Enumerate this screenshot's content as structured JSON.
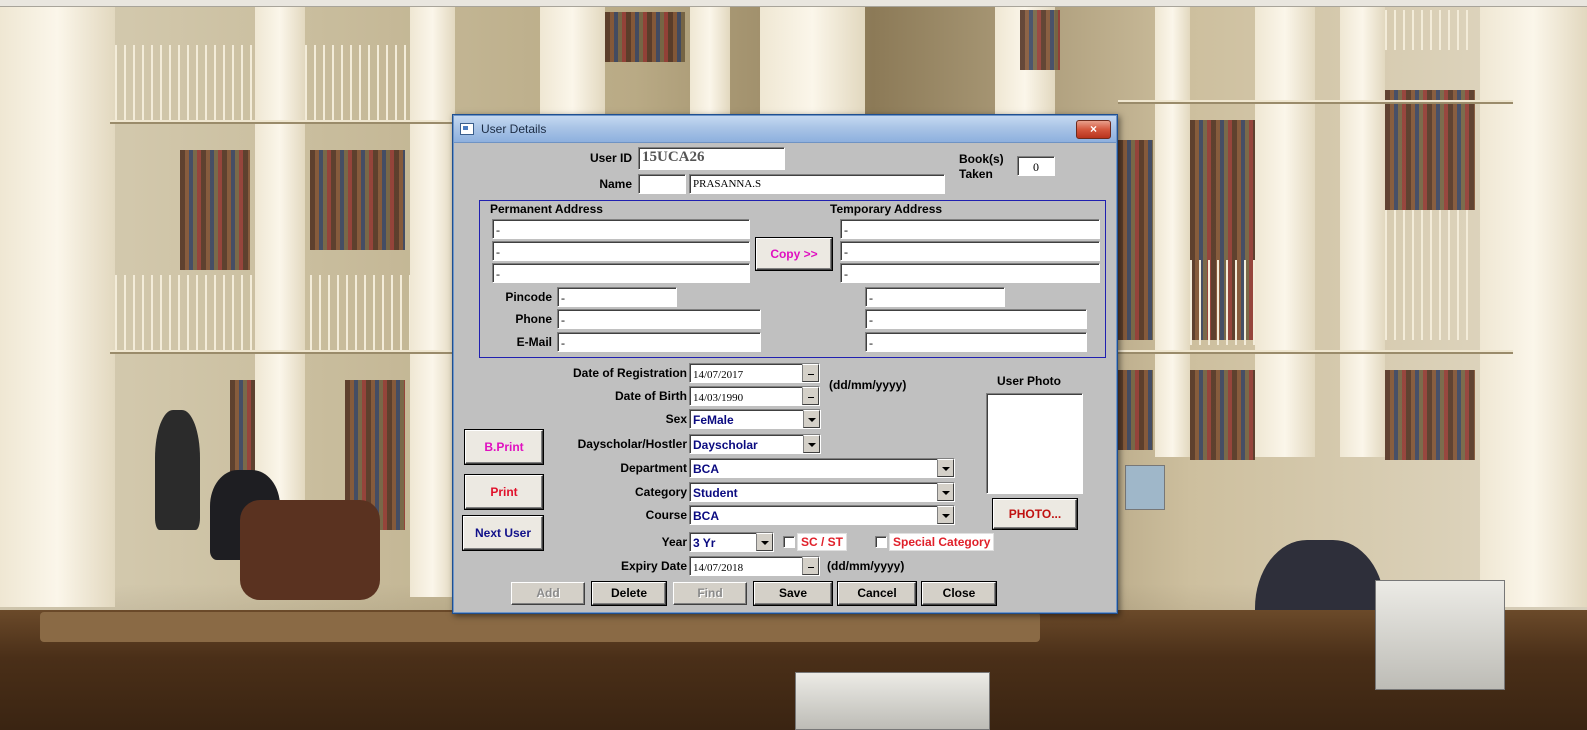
{
  "window": {
    "title": "User Details",
    "close_label": "×"
  },
  "user": {
    "user_id_label": "User ID",
    "user_id_value": "15UCA26",
    "name_label": "Name",
    "name_prefix_value": "",
    "name_value": "PRASANNA.S",
    "books_taken_label_1": "Book(s)",
    "books_taken_label_2": "Taken",
    "books_taken_value": "0"
  },
  "address": {
    "permanent_title": "Permanent Address",
    "temporary_title": "Temporary Address",
    "permanent_lines": [
      "-",
      "-",
      "-"
    ],
    "temporary_lines": [
      "-",
      "-",
      "-"
    ],
    "copy_button": "Copy >>",
    "pincode_label": "Pincode",
    "phone_label": "Phone",
    "email_label": "E-Mail",
    "pincode_value": "-",
    "phone_value": "-",
    "email_value": "-",
    "temp_pincode_value": "-",
    "temp_phone_value": "-",
    "temp_email_value": "-"
  },
  "details": {
    "registration_label": "Date of Registration",
    "registration_value": "14/07/2017",
    "dob_label": "Date of Birth",
    "dob_value": "14/03/1990",
    "date_format_hint": "(dd/mm/yyyy)",
    "sex_label": "Sex",
    "sex_value": "FeMale",
    "dayscholar_label": "Dayscholar/Hostler",
    "dayscholar_value": "Dayscholar",
    "department_label": "Department",
    "department_value": "BCA",
    "category_label": "Category",
    "category_value": "Student",
    "course_label": "Course",
    "course_value": "BCA",
    "year_label": "Year",
    "year_value": "3 Yr",
    "scst_label": "SC / ST",
    "special_category_label": "Special Category",
    "expiry_label": "Expiry Date",
    "expiry_value": "14/07/2018",
    "expiry_format_hint": "(dd/mm/yyyy)"
  },
  "photo": {
    "label": "User Photo",
    "button": "PHOTO..."
  },
  "side_buttons": {
    "bprint": "B.Print",
    "print": "Print",
    "next_user": "Next User"
  },
  "footer_buttons": {
    "add": "Add",
    "delete": "Delete",
    "find": "Find",
    "save": "Save",
    "cancel": "Cancel",
    "close": "Close"
  },
  "colors": {
    "dialog_bg": "#c0c0c0",
    "group_border": "#2020b0",
    "copy_text": "#e010c0",
    "bprint_text": "#e010c0",
    "print_text": "#e0102a",
    "next_user_text": "#10108a",
    "checkbox_label": "#e0202a",
    "combo_value": "#0a0a80",
    "photo_button_text": "#c01010"
  }
}
